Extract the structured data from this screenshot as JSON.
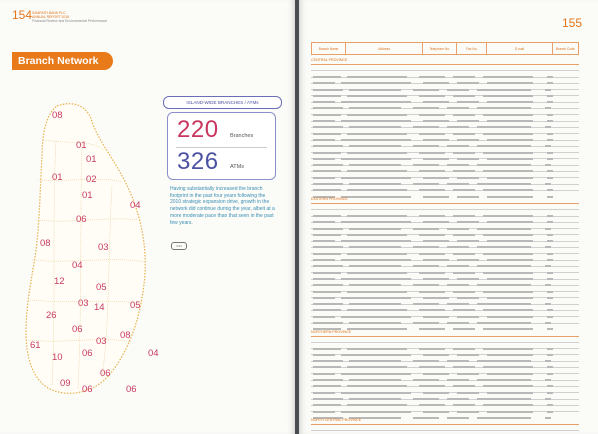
{
  "left_page": {
    "page_number": "154",
    "header_lines": [
      "SAMPATH BANK PLC",
      "ANNUAL REPORT 2016",
      "Financial Review and Environmental Performance"
    ],
    "section_tab": "Branch Network",
    "map": {
      "district_counts": [
        "08",
        "01",
        "01",
        "02",
        "01",
        "01",
        "04",
        "06",
        "08",
        "03",
        "04",
        "12",
        "05",
        "06",
        "03",
        "06",
        "14",
        "05",
        "07",
        "26",
        "06",
        "03",
        "08",
        "61",
        "04",
        "06",
        "10",
        "06",
        "09",
        "06",
        "06"
      ]
    },
    "stats": {
      "title": "ISLAND-WIDE BRANCHES / ATMs",
      "branches_value": "220",
      "branches_label": "Branches",
      "atms_value": "326",
      "atms_label": "ATMs"
    },
    "paragraph": "Having substantially increased the branch footprint in the past four years following the 2010 strategic expansion drive, growth in the network did continue during the year, albeit at a more moderate pace than that seen in the past few years.",
    "pill": "CS4"
  },
  "right_page": {
    "page_number": "155",
    "table_headers": [
      "Branch Name",
      "Address",
      "Telephone No.",
      "Fax No.",
      "E-mail",
      "Branch Code"
    ],
    "provinces": [
      "CENTRAL PROVINCE",
      "EASTERN PROVINCE",
      "NORTHERN PROVINCE",
      "NORTH CENTRAL PROVINCE"
    ]
  },
  "colors": {
    "accent": "#e87a1a",
    "magenta": "#c83760",
    "indigo": "#4c52a2",
    "cyan_text": "#3a8fb5"
  }
}
